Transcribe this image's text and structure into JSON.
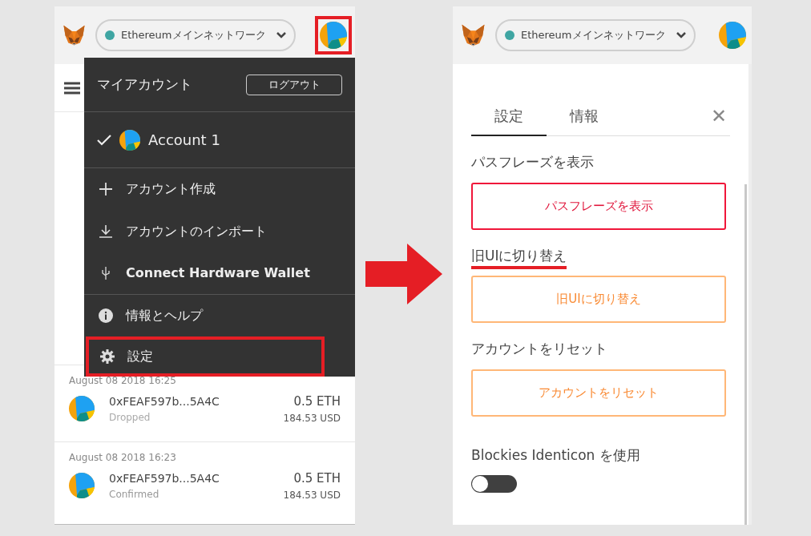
{
  "left_screen": {
    "header": {
      "network": "Ethereumメインネットワーク",
      "avatar_highlighted": true
    },
    "transactions": [
      {
        "date": "August 08 2018 16:25",
        "address": "0xFEAF597b...5A4C",
        "status": "Dropped",
        "amount": "0.5 ETH",
        "fiat": "184.53 USD"
      },
      {
        "date": "August 08 2018 16:23",
        "address": "0xFEAF597b...5A4C",
        "status": "Confirmed",
        "amount": "0.5 ETH",
        "fiat": "184.53 USD"
      }
    ],
    "menu": {
      "title": "マイアカウント",
      "logout": "ログアウト",
      "accounts": [
        {
          "name": "Account 1",
          "selected": true
        }
      ],
      "items": [
        {
          "kind": "plus",
          "label": "アカウント作成",
          "highlighted": false
        },
        {
          "kind": "download",
          "label": "アカウントのインポート",
          "highlighted": false
        },
        {
          "kind": "usb",
          "label": "Connect Hardware Wallet",
          "highlighted": false
        },
        {
          "kind": "info",
          "label": "情報とヘルプ",
          "highlighted": false
        },
        {
          "kind": "gear",
          "label": "設定",
          "highlighted": true
        }
      ]
    }
  },
  "right_screen": {
    "header": {
      "network": "Ethereumメインネットワーク",
      "avatar_highlighted": false
    },
    "tabs": [
      {
        "label": "設定",
        "selected": true
      },
      {
        "label": "情報",
        "selected": false
      }
    ],
    "close": "✕",
    "sections": [
      {
        "title": "パスフレーズを表示",
        "button": "パスフレーズを表示",
        "kind": "danger",
        "underlined": false
      },
      {
        "title": "旧UIに切り替え",
        "button": "旧UIに切り替え",
        "kind": "warning",
        "underlined": true
      },
      {
        "title": "アカウントをリセット",
        "button": "アカウントをリセット",
        "kind": "warning",
        "underlined": false
      }
    ],
    "toggle": {
      "label": "Blockies Identicon を使用",
      "on": false
    }
  }
}
